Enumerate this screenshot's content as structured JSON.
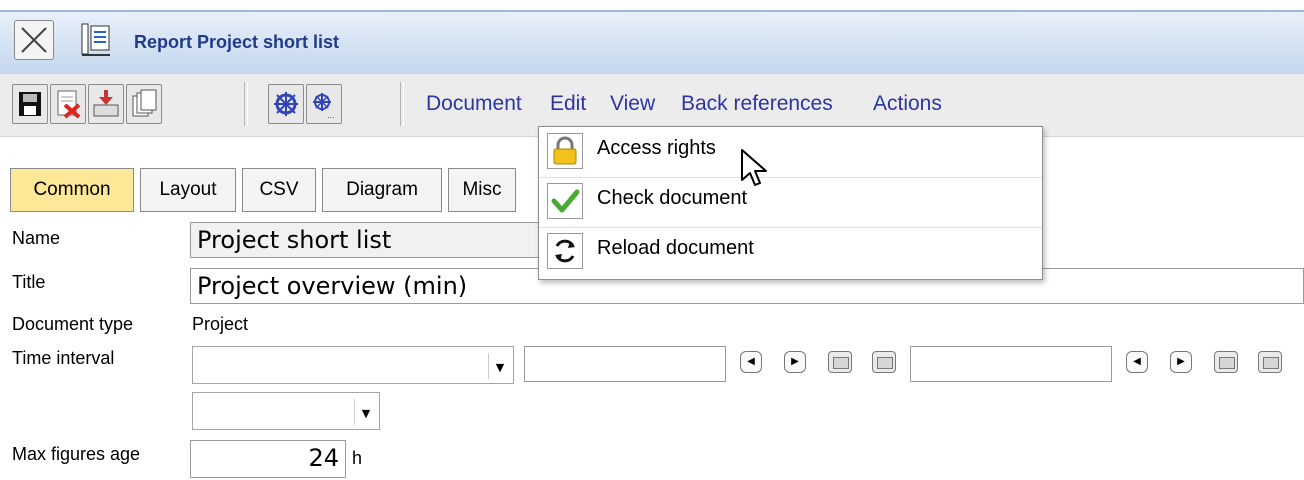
{
  "window": {
    "title": "Report Project short list"
  },
  "menubar": {
    "items": [
      "Document",
      "Edit",
      "View",
      "Back references",
      "Actions"
    ]
  },
  "dropdown": {
    "items": [
      "Access rights",
      "Check document",
      "Reload document"
    ]
  },
  "tabs": [
    "Common",
    "Layout",
    "CSV",
    "Diagram",
    "Misc"
  ],
  "form": {
    "name_label": "Name",
    "name_value": "Project short list",
    "title_label": "Title",
    "title_value": "Project overview (min)",
    "doctype_label": "Document type",
    "doctype_value": "Project",
    "interval_label": "Time interval",
    "maxage_label": "Max figures age",
    "maxage_value": "24",
    "maxage_unit": "h"
  },
  "colors": {
    "active_tab": "#fce896",
    "menu_text": "#2d35a6",
    "title_text": "#203b8a"
  },
  "icons": [
    "close-icon",
    "report-icon",
    "save-icon",
    "delete-icon",
    "export-icon",
    "copy-icon",
    "view-icon",
    "view-small-icon",
    "lock-icon",
    "check-icon",
    "reload-icon",
    "cursor-icon"
  ]
}
